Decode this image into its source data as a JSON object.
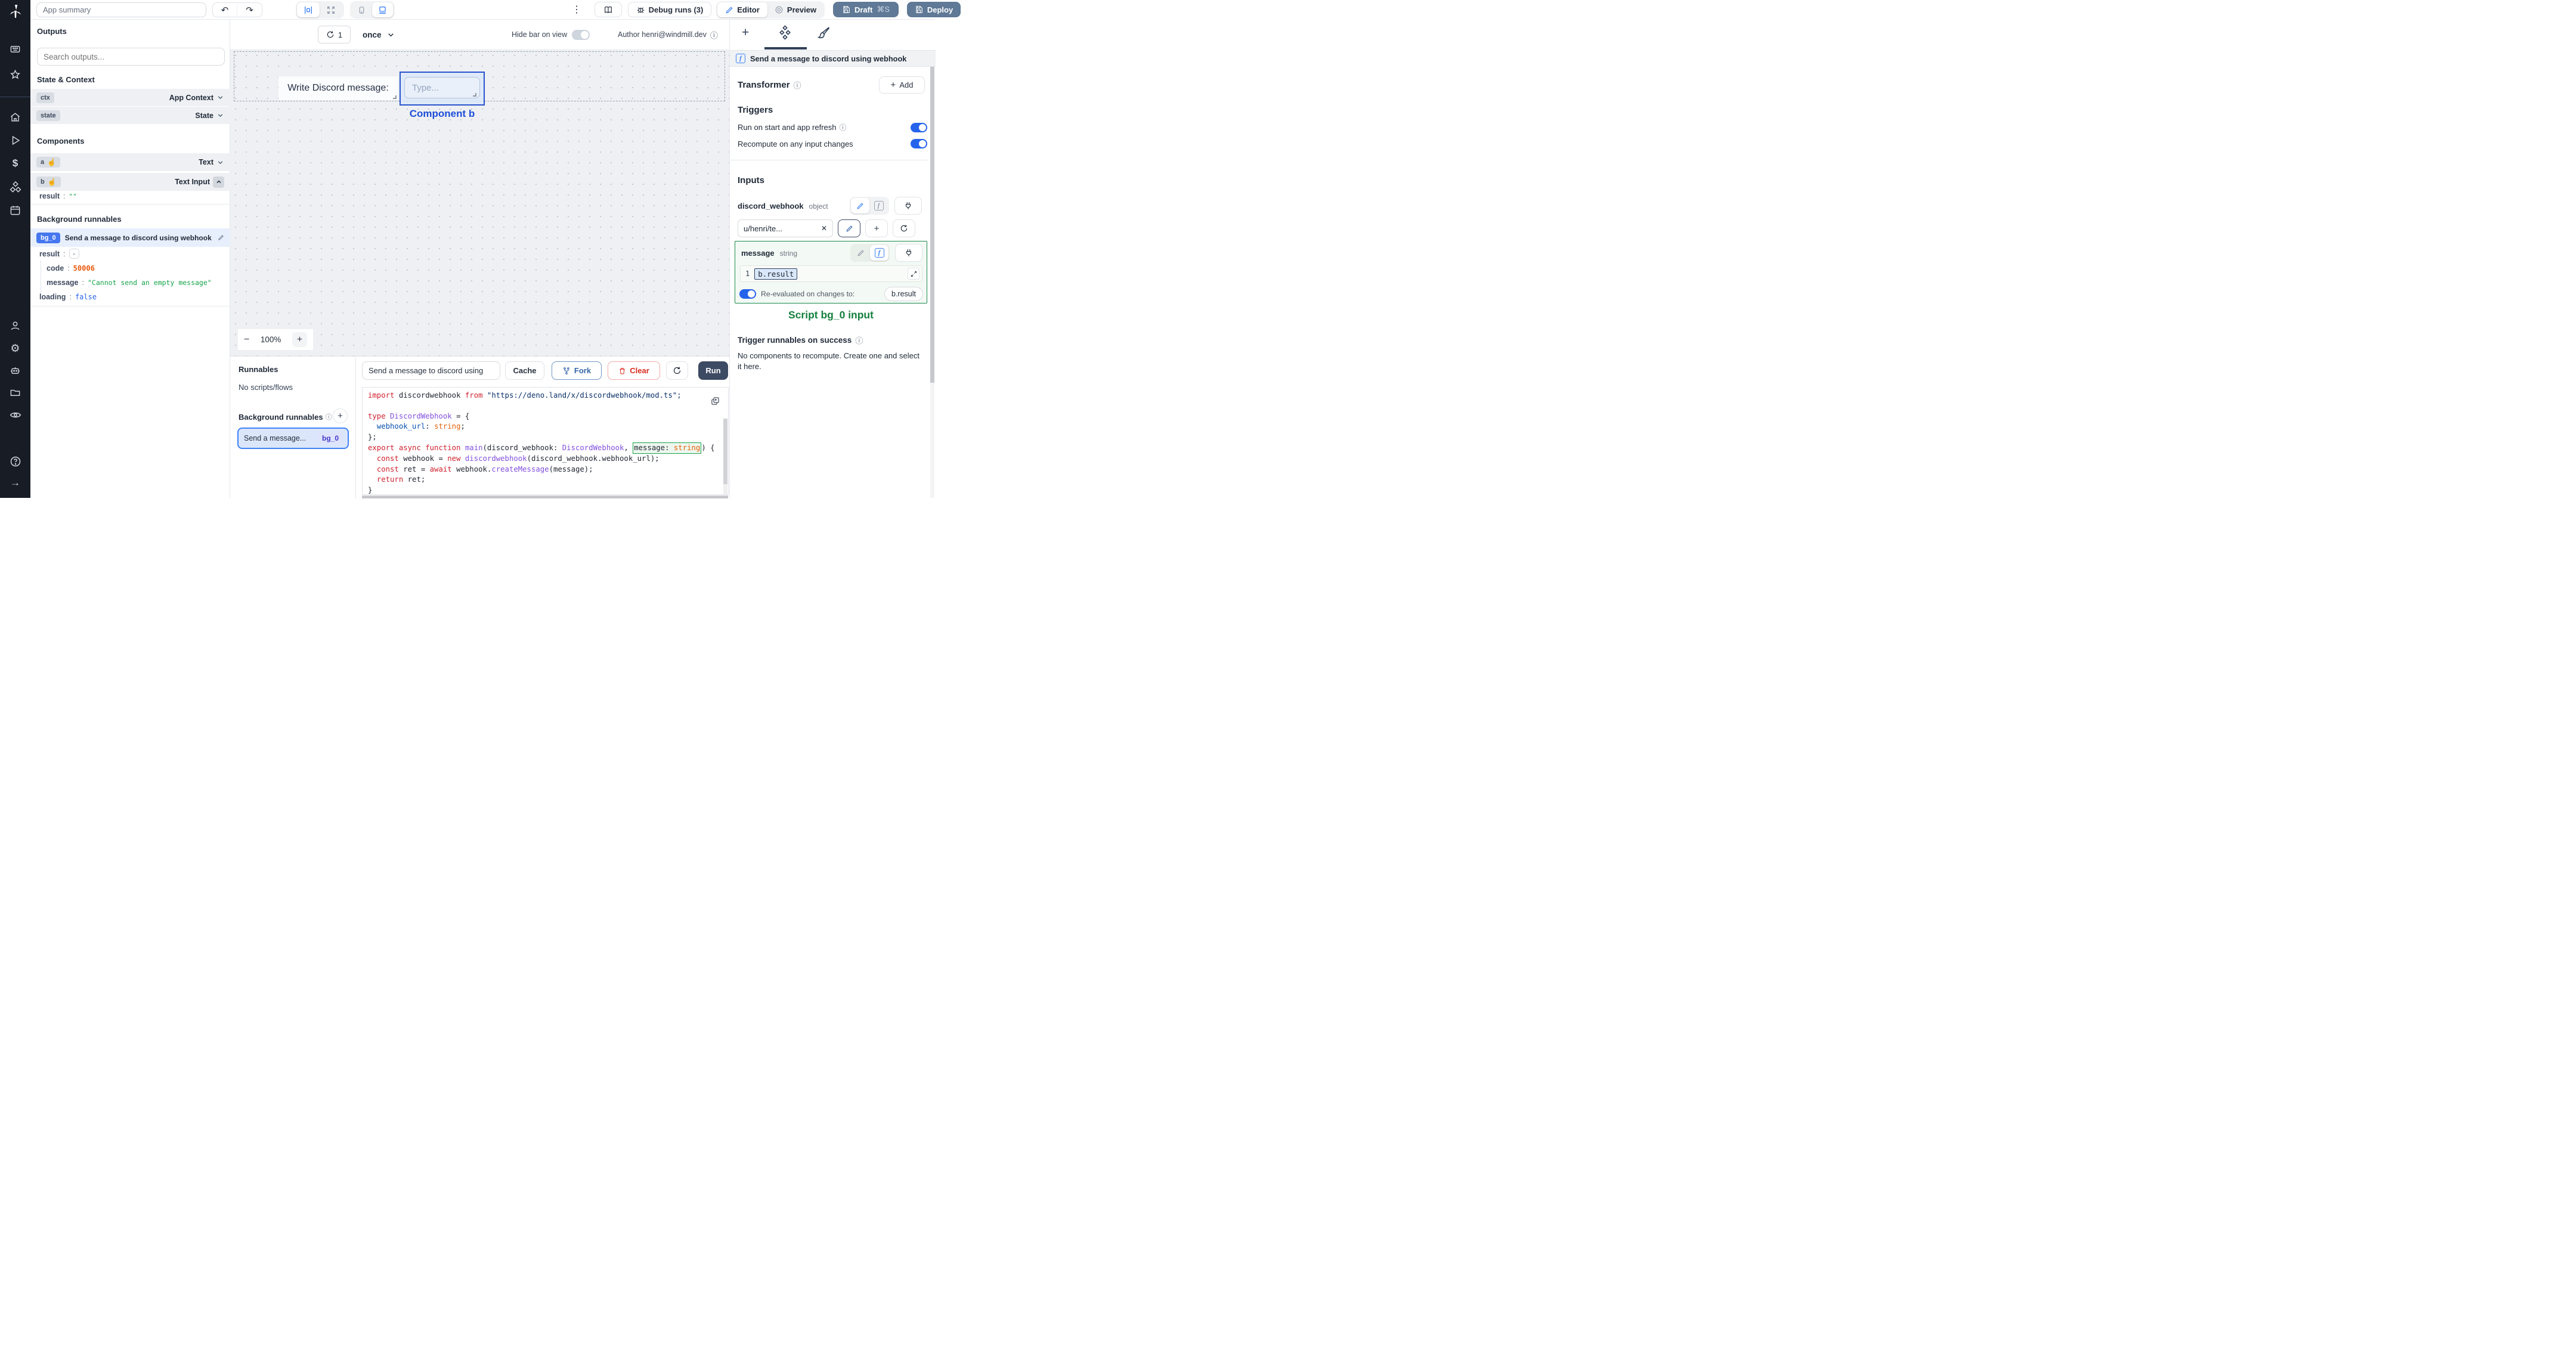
{
  "icons": {
    "kebab": "⋮",
    "undo": "↶",
    "redo": "↷",
    "info": "ⓘ",
    "close": "✕",
    "minus": "−",
    "plus": "+",
    "star": "☆",
    "gear": "⚙",
    "dollar": "$",
    "play": "▷",
    "arrow_right": "→",
    "hand": "☝",
    "dash": "-",
    "refresh_count": "1"
  },
  "topbar": {
    "app_summary_placeholder": "App summary",
    "debug_runs_label": "Debug runs  (3)",
    "editor_label": "Editor",
    "preview_label": "Preview",
    "draft_label": "Draft",
    "draft_shortcut": "⌘S",
    "deploy_label": "Deploy"
  },
  "outputs_panel": {
    "title": "Outputs",
    "search_placeholder": "Search outputs...",
    "state_context_title": "State & Context",
    "ctx_badge": "ctx",
    "ctx_type": "App Context",
    "state_badge": "state",
    "state_type": "State",
    "components_title": "Components",
    "a_badge": "a",
    "a_type": "Text",
    "b_badge": "b",
    "b_type": "Text Input",
    "b_result_key": "result",
    "b_result_value": "\"\"",
    "background_title": "Background runnables",
    "bg0_badge": "bg_0",
    "bg0_title": "Send a message to discord using webhook",
    "result_key": "result",
    "result_toggle": "-",
    "code_key": "code",
    "code_value": "50006",
    "message_key": "message",
    "message_value": "\"Cannot send an empty message\"",
    "loading_key": "loading",
    "loading_value": "false"
  },
  "canvas": {
    "refresh_count": "1",
    "schedule": "once",
    "hide_bar_label": "Hide bar on view",
    "author_label": "Author henri@windmill.dev",
    "text_component": "Write Discord message:",
    "input_placeholder": "Type...",
    "selected_label": "Component b",
    "zoom_value": "100%",
    "zoom_minus": "−",
    "zoom_plus": "+"
  },
  "runnables": {
    "title": "Runnables",
    "empty": "No scripts/flows",
    "background_title": "Background runnables",
    "item_title": "Send a message...",
    "item_badge": "bg_0"
  },
  "editor": {
    "name_value": "Send a message to discord using",
    "cache_label": "Cache",
    "fork_label": "Fork",
    "clear_label": "Clear",
    "run_label": "Run"
  },
  "code": {
    "lines": [
      [
        {
          "t": "import ",
          "c": "k"
        },
        {
          "t": "discordwebhook ",
          "c": "p"
        },
        {
          "t": "from ",
          "c": "k"
        },
        {
          "t": "\"https://deno.land/x/discordwebhook/mod.ts\";",
          "c": "s"
        }
      ],
      [],
      [
        {
          "t": "type ",
          "c": "k"
        },
        {
          "t": "DiscordWebhook ",
          "c": "t"
        },
        {
          "t": "= {",
          "c": "p"
        }
      ],
      [
        {
          "t": "  ",
          "c": "p"
        },
        {
          "t": "webhook_url",
          "c": "b"
        },
        {
          "t": ": ",
          "c": "p"
        },
        {
          "t": "string",
          "c": "o"
        },
        {
          "t": ";",
          "c": "p"
        }
      ],
      [
        {
          "t": "};",
          "c": "p"
        }
      ],
      [
        {
          "t": "export ",
          "c": "k"
        },
        {
          "t": "async ",
          "c": "k"
        },
        {
          "t": "function ",
          "c": "k"
        },
        {
          "t": "main",
          "c": "f"
        },
        {
          "t": "(discord_webhook: ",
          "c": "p"
        },
        {
          "t": "DiscordWebhook",
          "c": "t"
        },
        {
          "t": ", ",
          "c": "p"
        },
        {
          "t": "message: ",
          "c": "p",
          "box": 1
        },
        {
          "t": "string",
          "c": "o",
          "box": 1
        },
        {
          "t": ") {",
          "c": "p"
        }
      ],
      [
        {
          "t": "  ",
          "c": "p"
        },
        {
          "t": "const ",
          "c": "k"
        },
        {
          "t": "webhook = ",
          "c": "p"
        },
        {
          "t": "new ",
          "c": "k"
        },
        {
          "t": "discordwebhook",
          "c": "f"
        },
        {
          "t": "(discord_webhook.webhook_url);",
          "c": "p"
        }
      ],
      [
        {
          "t": "  ",
          "c": "p"
        },
        {
          "t": "const ",
          "c": "k"
        },
        {
          "t": "ret = ",
          "c": "p"
        },
        {
          "t": "await ",
          "c": "k"
        },
        {
          "t": "webhook.",
          "c": "p"
        },
        {
          "t": "createMessage",
          "c": "f"
        },
        {
          "t": "(message);",
          "c": "p"
        }
      ],
      [
        {
          "t": "  ",
          "c": "p"
        },
        {
          "t": "return ",
          "c": "k"
        },
        {
          "t": "ret;",
          "c": "p"
        }
      ],
      [
        {
          "t": "}",
          "c": "p"
        }
      ]
    ]
  },
  "right_panel": {
    "header": "Send a message to discord using webhook",
    "transformer_label": "Transformer",
    "add_label": "Add",
    "triggers_title": "Triggers",
    "trigger1": "Run on start and app refresh",
    "trigger2": "Recompute on any input changes",
    "inputs_title": "Inputs",
    "field1_name": "discord_webhook",
    "field1_type": "object",
    "field1_value": "u/henri/te...",
    "field2_name": "message",
    "field2_type": "string",
    "expr_line_no": "1",
    "expr_value": "b.result",
    "reeval_label": "Re-evaluated on changes to:",
    "reeval_target": "b.result",
    "script_input_label": "Script bg_0 input",
    "trigger_success_label": "Trigger runnables on success",
    "empty_text": "No components to recompute. Create one and select it here."
  },
  "colors": {
    "accent_blue": "#3b82f6",
    "selection_blue": "#2954cc",
    "slate_button": "#5f7996",
    "green": "#15803d",
    "error_orange": "#ea580c",
    "string_green": "#16a34a"
  }
}
